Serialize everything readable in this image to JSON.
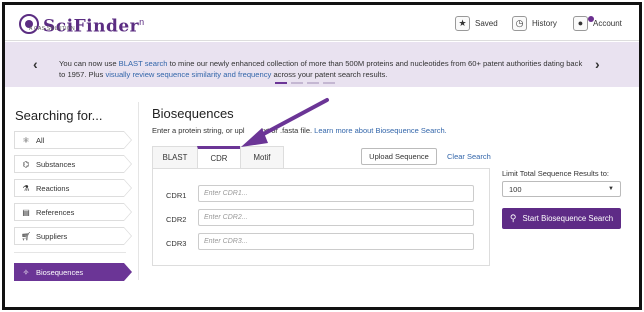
{
  "header": {
    "logo_text": "SciFinder",
    "logo_superscript": "n",
    "logo_tagline": "A CAS SOLUTION",
    "saved_label": "Saved",
    "history_label": "History",
    "account_label": "Account"
  },
  "banner": {
    "text_1": "You can now use ",
    "link_1": "BLAST search",
    "text_2": " to mine our newly enhanced collection of more than 500M proteins and nucleotides from 60+ patent authorities dating back to 1957. Plus ",
    "link_2": "visually review sequence similarity and frequency",
    "text_3": " across your patent search results.",
    "prev_icon": "chevron-left-icon",
    "next_icon": "chevron-right-icon"
  },
  "sidebar": {
    "title": "Searching for...",
    "items": [
      {
        "label": "All",
        "icon": "atom-icon"
      },
      {
        "label": "Substances",
        "icon": "substance-icon"
      },
      {
        "label": "Reactions",
        "icon": "flask-icon"
      },
      {
        "label": "References",
        "icon": "document-icon"
      },
      {
        "label": "Suppliers",
        "icon": "cart-icon"
      },
      {
        "label": "Biosequences",
        "icon": "dna-icon"
      }
    ],
    "active": "Biosequences"
  },
  "main": {
    "title": "Biosequences",
    "desc_prefix": "Enter a protein string, or upl",
    "desc_middle": "txt or .fasta file. ",
    "desc_link": "Learn more about Biosequence Search.",
    "tabs": [
      "BLAST",
      "CDR",
      "Motif"
    ],
    "active_tab": "CDR",
    "upload_label": "Upload Sequence",
    "clear_label": "Clear Search",
    "cdr_fields": [
      {
        "label": "CDR1",
        "placeholder": "Enter CDR1..."
      },
      {
        "label": "CDR2",
        "placeholder": "Enter CDR2..."
      },
      {
        "label": "CDR3",
        "placeholder": "Enter CDR3..."
      }
    ]
  },
  "options": {
    "limit_label": "Limit Total Sequence Results to:",
    "limit_value": "100",
    "start_label": "Start Biosequence Search"
  },
  "colors": {
    "brand_purple": "#5e2b86",
    "banner_bg": "#e9e2f0",
    "link_blue": "#3366aa",
    "annotation_arrow": "#6b3596"
  }
}
